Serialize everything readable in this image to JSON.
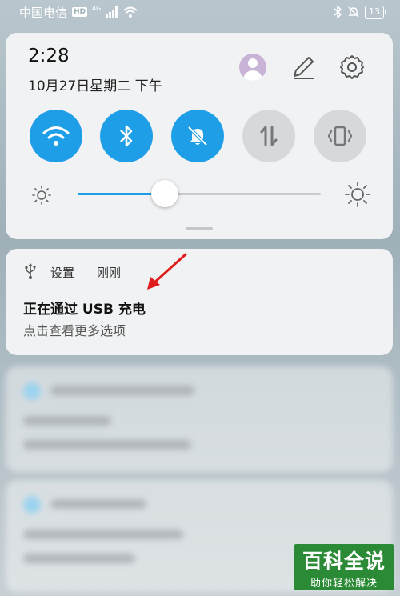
{
  "status_bar": {
    "carrier": "中国电信",
    "hd": "HD",
    "network": "4G",
    "battery": "13"
  },
  "quick_settings": {
    "time": "2:28",
    "date": "10月27日星期二 下午",
    "toggles": [
      {
        "name": "wifi",
        "state": "on",
        "icon": "wifi-icon"
      },
      {
        "name": "bluetooth",
        "state": "on",
        "icon": "bluetooth-icon"
      },
      {
        "name": "silent",
        "state": "on",
        "icon": "bell-off-icon"
      },
      {
        "name": "mobile-data",
        "state": "off",
        "icon": "data-arrows-icon"
      },
      {
        "name": "vibrate",
        "state": "off",
        "icon": "vibrate-icon"
      }
    ],
    "brightness_level": 0.36,
    "accent_color": "#1f9ee8"
  },
  "notification": {
    "app": "设置",
    "time": "刚刚",
    "title": "正在通过 USB 充电",
    "text": "点击查看更多选项",
    "icon": "usb-icon"
  },
  "watermark": {
    "title": "百科全说",
    "subtitle": "助你轻松解决"
  }
}
